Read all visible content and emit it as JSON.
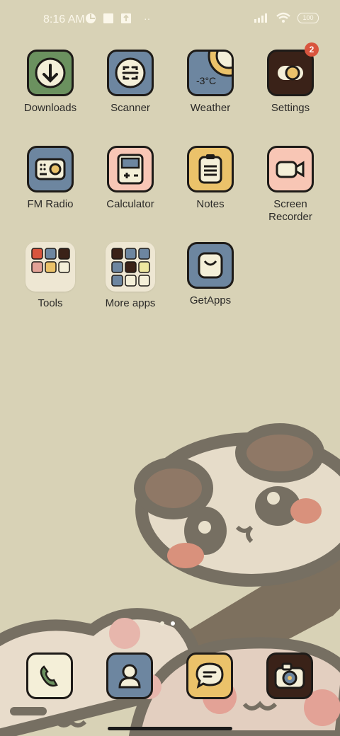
{
  "status": {
    "time": "8:16 AM",
    "battery": "100",
    "more_symbol": "··"
  },
  "apps": [
    {
      "label": "Downloads",
      "icon": "download-icon",
      "bg": "#6b915f"
    },
    {
      "label": "Scanner",
      "icon": "scanner-icon",
      "bg": "#6d86a0"
    },
    {
      "label": "Weather",
      "icon": "weather-icon",
      "bg": "#6d86a0",
      "temp": "-3°C"
    },
    {
      "label": "Settings",
      "icon": "settings-toggle-icon",
      "bg": "#3a2218",
      "badge": "2"
    },
    {
      "label": "FM Radio",
      "icon": "radio-icon",
      "bg": "#6d86a0"
    },
    {
      "label": "Calculator",
      "icon": "calculator-icon",
      "bg": "#f8c6b5"
    },
    {
      "label": "Notes",
      "icon": "notes-icon",
      "bg": "#ebc26a"
    },
    {
      "label": "Screen\nRecorder",
      "icon": "video-camera-icon",
      "bg": "#f8c6b5"
    },
    {
      "label": "GetApps",
      "icon": "getapps-icon",
      "bg": "#6d86a0"
    }
  ],
  "folders": [
    {
      "label": "Tools"
    },
    {
      "label": "More apps"
    }
  ],
  "dock": [
    {
      "icon": "phone-icon",
      "bg": "#f4efd8"
    },
    {
      "icon": "contacts-icon",
      "bg": "#6d86a0"
    },
    {
      "icon": "messages-icon",
      "bg": "#ebc26a"
    },
    {
      "icon": "camera-icon",
      "bg": "#3a2218"
    }
  ]
}
